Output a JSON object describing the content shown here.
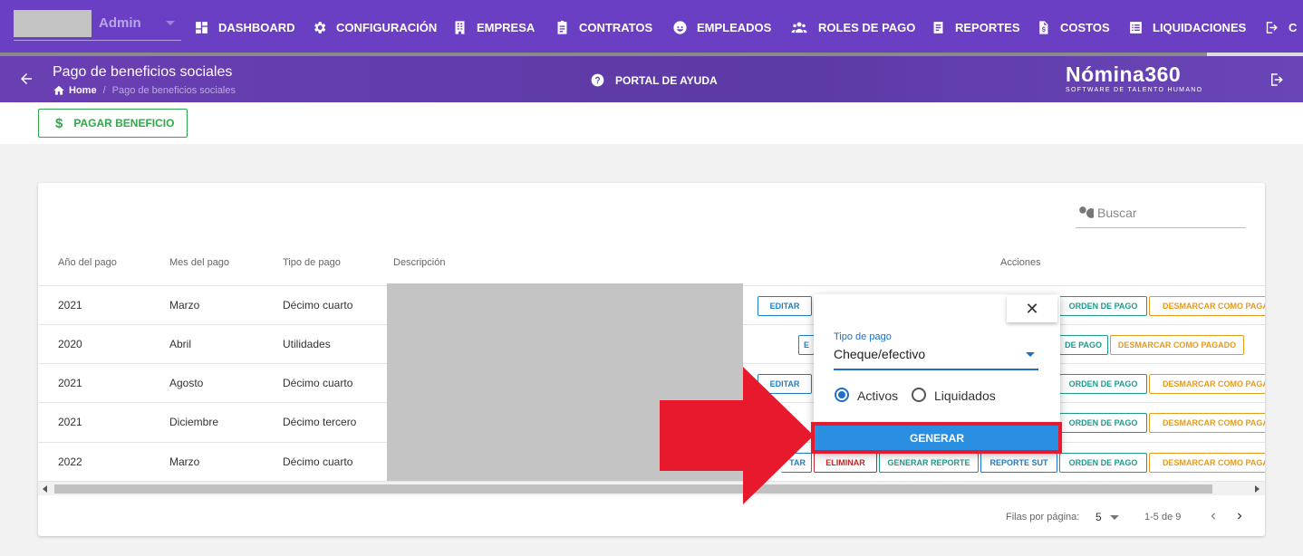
{
  "topnav": {
    "user": "Admin",
    "items": [
      {
        "label": "DASHBOARD",
        "icon": "dashboard-icon"
      },
      {
        "label": "CONFIGURACIÓN",
        "icon": "gear-icon"
      },
      {
        "label": "EMPRESA",
        "icon": "building-icon"
      },
      {
        "label": "CONTRATOS",
        "icon": "clipboard-icon"
      },
      {
        "label": "EMPLEADOS",
        "icon": "face-icon"
      },
      {
        "label": "ROLES DE PAGO",
        "icon": "group-icon"
      },
      {
        "label": "REPORTES",
        "icon": "report-icon"
      },
      {
        "label": "COSTOS",
        "icon": "file-dollar-icon"
      },
      {
        "label": "LIQUIDACIONES",
        "icon": "list-icon"
      },
      {
        "label": "C",
        "icon": "logout-icon"
      }
    ]
  },
  "subheader": {
    "title": "Pago de beneficios sociales",
    "breadcrumb_home": "Home",
    "breadcrumb_sep": "/",
    "breadcrumb_current": "Pago de beneficios sociales",
    "help": "PORTAL DE AYUDA",
    "logo": "Nómina360",
    "logo_tag": "SOFTWARE DE TALENTO HUMANO"
  },
  "toolbar": {
    "pay_icon": "$",
    "pay_label": "PAGAR BENEFICIO",
    "accent": "#2ea84a"
  },
  "table": {
    "search_placeholder": "Buscar",
    "headers": [
      "Año del pago",
      "Mes del pago",
      "Tipo de pago",
      "Descripción",
      "Acciones"
    ],
    "rows": [
      {
        "year": "2021",
        "month": "Marzo",
        "type": "Décimo cuarto"
      },
      {
        "year": "2020",
        "month": "Abril",
        "type": "Utilidades"
      },
      {
        "year": "2021",
        "month": "Agosto",
        "type": "Décimo cuarto"
      },
      {
        "year": "2021",
        "month": "Diciembre",
        "type": "Décimo tercero"
      },
      {
        "year": "2022",
        "month": "Marzo",
        "type": "Décimo cuarto"
      }
    ],
    "actions": {
      "edit": "EDITAR",
      "edit_partial": "E",
      "edit_tail": "TAR",
      "delete": "ELIMINAR",
      "gen_report": "GENERAR REPORTE",
      "report_sut": "REPORTE SUT",
      "pay_order": "ORDEN DE PAGO",
      "pay_order_partial": "DE PAGO",
      "unmark": "DESMARCAR COMO PAGADO"
    },
    "footer": {
      "rows_per_page_label": "Filas por página:",
      "rows_per_page": "5",
      "range": "1-5 de 9"
    }
  },
  "popup": {
    "close": "✕",
    "field_label": "Tipo de pago",
    "field_value": "Cheque/efectivo",
    "radio_active": "Activos",
    "radio_liquidated": "Liquidados",
    "selected": "Activos",
    "generate": "GENERAR"
  },
  "colors": {
    "nav": "#6a3fc4",
    "primary": "#2a8fe0",
    "highlight": "#e8192c"
  }
}
